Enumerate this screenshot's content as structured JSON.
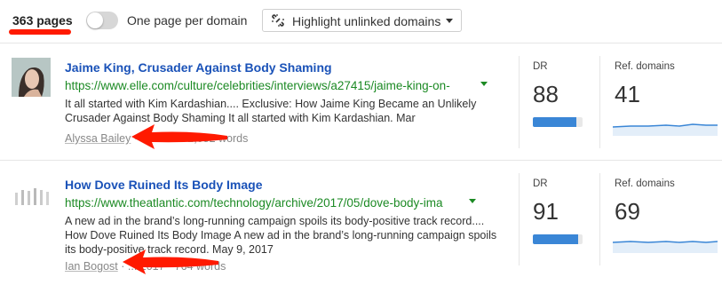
{
  "toolbar": {
    "pages_count": "363 pages",
    "toggle_label": "One page per domain",
    "toggle_on": false,
    "highlight_label": "Highlight unlinked domains"
  },
  "results": [
    {
      "title": "Jaime King, Crusader Against Body Shaming",
      "url": "https://www.elle.com/culture/celebrities/interviews/a27415/jaime-king-on-",
      "snippet": "It all started with Kim Kardashian.... Exclusive: How Jaime King Became an Unlikely Crusader Against Body Shaming It all started with Kim Kardashian. Mar",
      "author": "Alyssa Bailey",
      "meta_rest": " · ... 2015 · 2,082 words",
      "dr_label": "DR",
      "dr_value": "88",
      "dr_fraction": 0.88,
      "ref_label": "Ref. domains",
      "ref_value": "41"
    },
    {
      "title": "How Dove Ruined Its Body Image",
      "url": "https://www.theatlantic.com/technology/archive/2017/05/dove-body-ima",
      "snippet": "A new ad in the brand’s long-running campaign spoils its body-positive track record.... How Dove Ruined Its Body Image A new ad in the brand’s long-running campaign spoils its body-positive track record. May 9, 2017",
      "author": "Ian Bogost",
      "meta_rest": " · ... 2017 · 764 words",
      "dr_label": "DR",
      "dr_value": "91",
      "dr_fraction": 0.91,
      "ref_label": "Ref. domains",
      "ref_value": "69"
    }
  ],
  "colors": {
    "title_link": "#1a52b8",
    "url_green": "#1c8a24",
    "dr_bar": "#3a86d6",
    "annotation_red": "#ff1a00"
  }
}
